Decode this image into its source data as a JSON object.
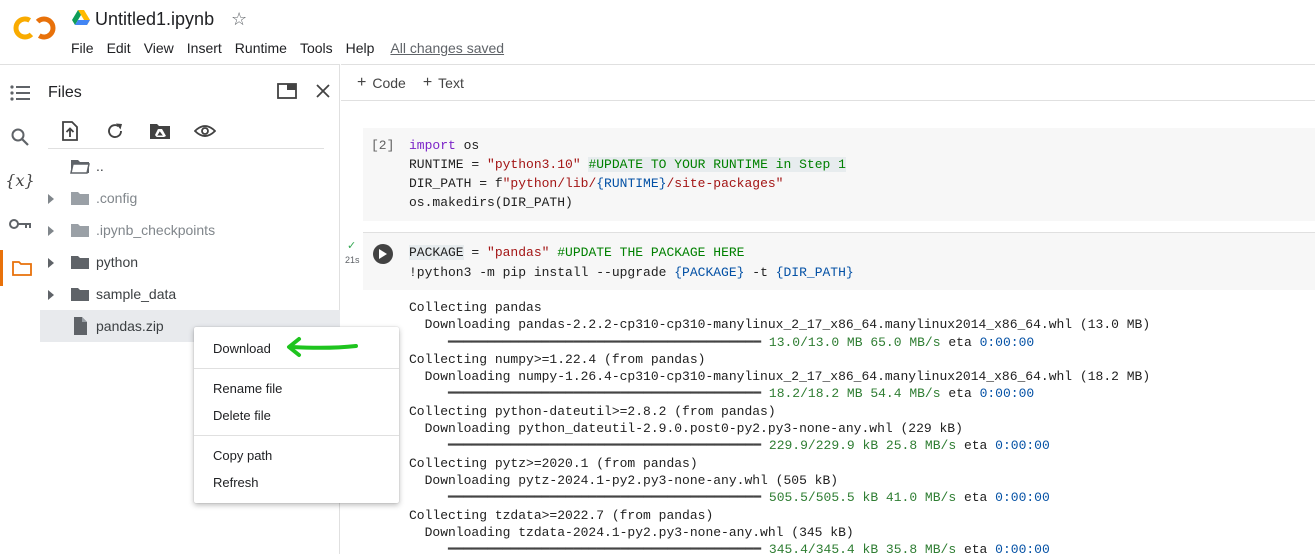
{
  "header": {
    "title": "Untitled1.ipynb",
    "menu": [
      "File",
      "Edit",
      "View",
      "Insert",
      "Runtime",
      "Tools",
      "Help"
    ],
    "save_status": "All changes saved",
    "colors": {
      "logo_orange": "#F9AB00",
      "logo_dark": "#E8710A"
    }
  },
  "files_panel": {
    "title": "Files",
    "tree": [
      {
        "label": "..",
        "type": "parent-folder"
      },
      {
        "label": ".config",
        "type": "folder"
      },
      {
        "label": ".ipynb_checkpoints",
        "type": "folder"
      },
      {
        "label": "python",
        "type": "folder"
      },
      {
        "label": "sample_data",
        "type": "folder"
      },
      {
        "label": "pandas.zip",
        "type": "file"
      }
    ]
  },
  "context_menu": {
    "items": [
      "Download",
      "Rename file",
      "Delete file",
      "Copy path",
      "Refresh"
    ]
  },
  "notebook": {
    "add_code": "Code",
    "add_text": "Text",
    "cell1": {
      "execution_count": "[2]",
      "line1_kw": "import",
      "line1_rest": " os",
      "line2_a": "RUNTIME = ",
      "line2_str": "\"python3.10\"",
      "line2_cmt": "#UPDATE TO YOUR RUNTIME in Step 1",
      "line3_a": "DIR_PATH = f",
      "line3_str1": "\"python/lib/",
      "line3_brace": "{RUNTIME}",
      "line3_str2": "/site-packages\"",
      "line4": "os.makedirs(DIR_PATH)"
    },
    "cell2": {
      "status_time": "21s",
      "line1_a": "PACKAGE",
      "line1_b": " = ",
      "line1_str": "\"pandas\"",
      "line1_cmt": " #UPDATE THE PACKAGE HERE",
      "line2_a": "!python3 -m pip install --upgrade ",
      "line2_b1": "{PACKAGE}",
      "line2_c": " -t ",
      "line2_b2": "{DIR_PATH}",
      "output": [
        {
          "collect": "Collecting pandas",
          "download": "  Downloading pandas-2.2.2-cp310-cp310-manylinux_2_17_x86_64.manylinux2014_x86_64.whl (13.0 MB)",
          "progress": "13.0/13.0 MB 65.0 MB/s",
          "eta": "0:00:00"
        },
        {
          "collect": "Collecting numpy>=1.22.4 (from pandas)",
          "download": "  Downloading numpy-1.26.4-cp310-cp310-manylinux_2_17_x86_64.manylinux2014_x86_64.whl (18.2 MB)",
          "progress": "18.2/18.2 MB 54.4 MB/s",
          "eta": "0:00:00"
        },
        {
          "collect": "Collecting python-dateutil>=2.8.2 (from pandas)",
          "download": "  Downloading python_dateutil-2.9.0.post0-py2.py3-none-any.whl (229 kB)",
          "progress": "229.9/229.9 kB 25.8 MB/s",
          "eta": "0:00:00"
        },
        {
          "collect": "Collecting pytz>=2020.1 (from pandas)",
          "download": "  Downloading pytz-2024.1-py2.py3-none-any.whl (505 kB)",
          "progress": "505.5/505.5 kB 41.0 MB/s",
          "eta": "0:00:00"
        },
        {
          "collect": "Collecting tzdata>=2022.7 (from pandas)",
          "download": "  Downloading tzdata-2024.1-py2.py3-none-any.whl (345 kB)",
          "progress": "345.4/345.4 kB 35.8 MB/s",
          "eta": "0:00:00"
        }
      ],
      "eta_label": "eta",
      "progress_bar": "━━━━━━━━━━━━━━━━━━━━━━━━━━━━━━━━━━━━━━━━"
    }
  },
  "annotation": {
    "arrow_color": "#1ec41e"
  }
}
